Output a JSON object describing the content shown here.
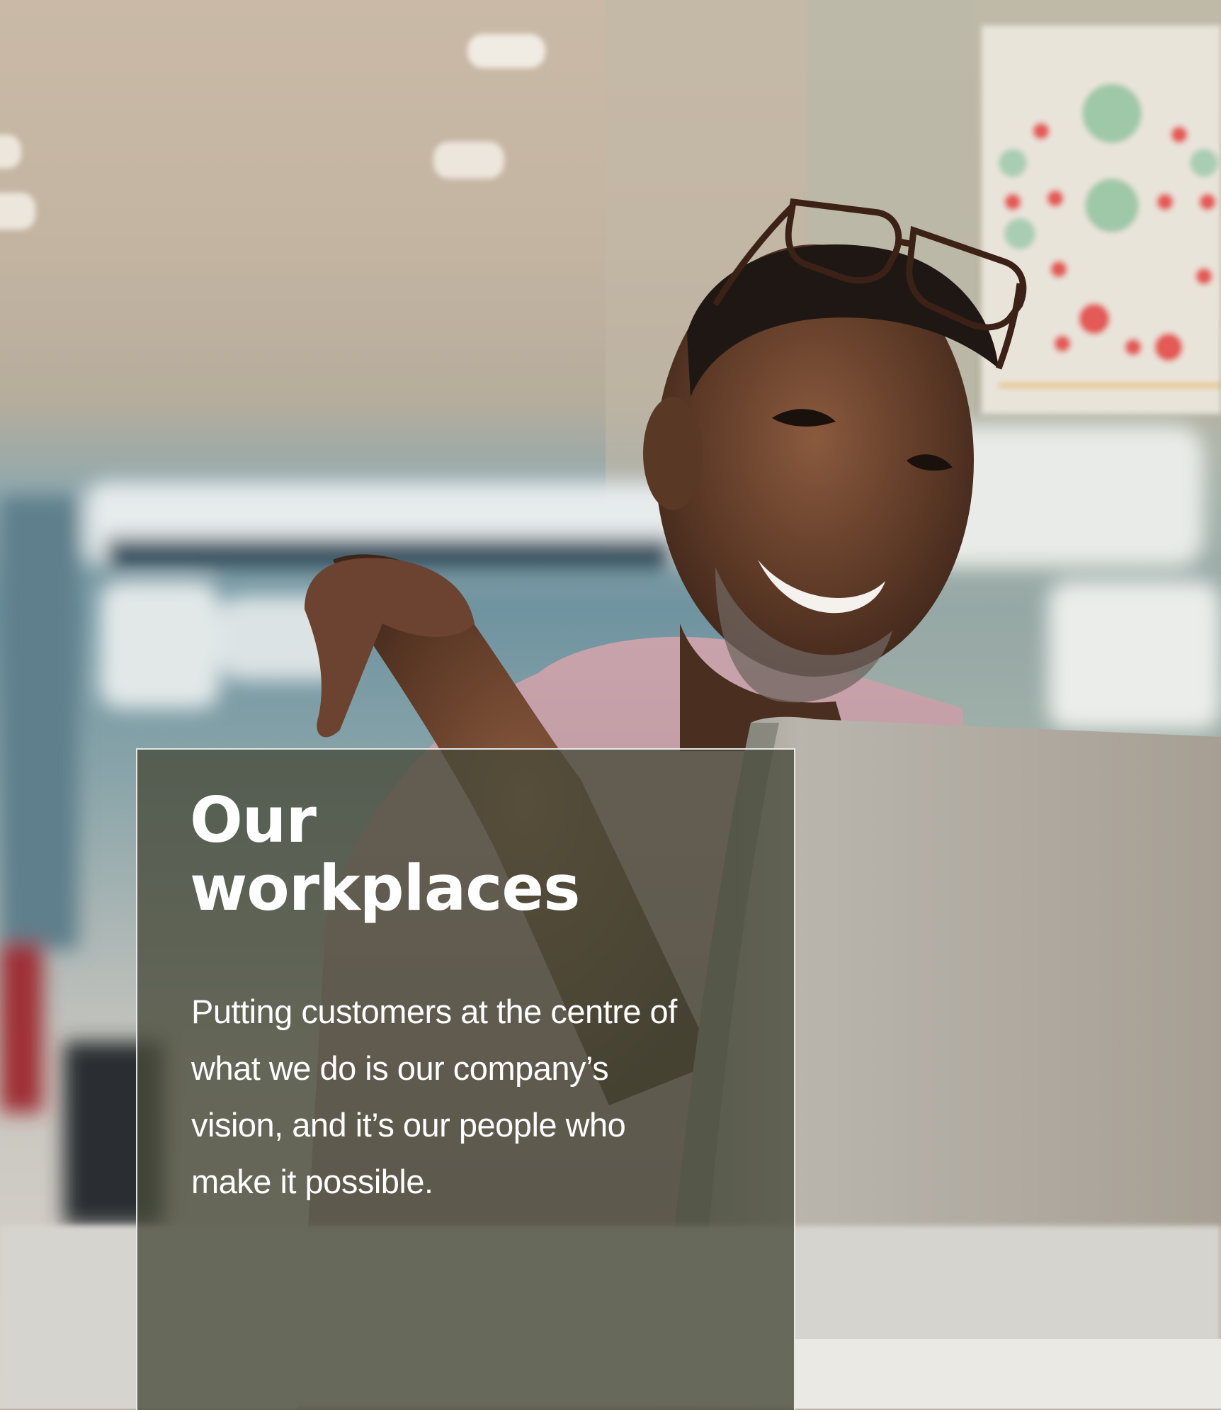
{
  "panel": {
    "title_line1": "Our",
    "title_line2": "workplaces",
    "body": "Putting customers at the centre of what we do is our company’s vision, and it’s our people who make it possible."
  },
  "colors": {
    "panel_overlay": "#484a3a",
    "panel_border": "#ffffff",
    "text": "#ffffff"
  }
}
